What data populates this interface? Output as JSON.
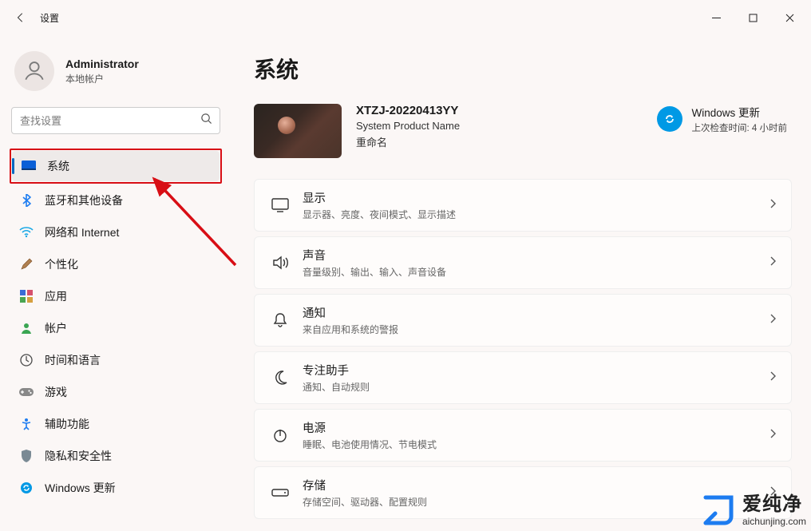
{
  "window": {
    "title": "设置"
  },
  "profile": {
    "name": "Administrator",
    "subtitle": "本地帐户"
  },
  "search": {
    "placeholder": "查找设置"
  },
  "nav": {
    "items": [
      {
        "label": "系统"
      },
      {
        "label": "蓝牙和其他设备"
      },
      {
        "label": "网络和 Internet"
      },
      {
        "label": "个性化"
      },
      {
        "label": "应用"
      },
      {
        "label": "帐户"
      },
      {
        "label": "时间和语言"
      },
      {
        "label": "游戏"
      },
      {
        "label": "辅助功能"
      },
      {
        "label": "隐私和安全性"
      },
      {
        "label": "Windows 更新"
      }
    ]
  },
  "main": {
    "title": "系统",
    "device": {
      "name": "XTZJ-20220413YY",
      "product": "System Product Name",
      "rename": "重命名"
    },
    "windows_update": {
      "title": "Windows 更新",
      "status": "上次检查时间: 4 小时前"
    },
    "cards": [
      {
        "title": "显示",
        "subtitle": "显示器、亮度、夜间模式、显示描述"
      },
      {
        "title": "声音",
        "subtitle": "音量级别、输出、输入、声音设备"
      },
      {
        "title": "通知",
        "subtitle": "来自应用和系统的警报"
      },
      {
        "title": "专注助手",
        "subtitle": "通知、自动规则"
      },
      {
        "title": "电源",
        "subtitle": "睡眠、电池使用情况、节电模式"
      },
      {
        "title": "存储",
        "subtitle": "存储空间、驱动器、配置规则"
      }
    ]
  },
  "brand": {
    "cn": "爱纯净",
    "en": "aichunjing.com"
  }
}
